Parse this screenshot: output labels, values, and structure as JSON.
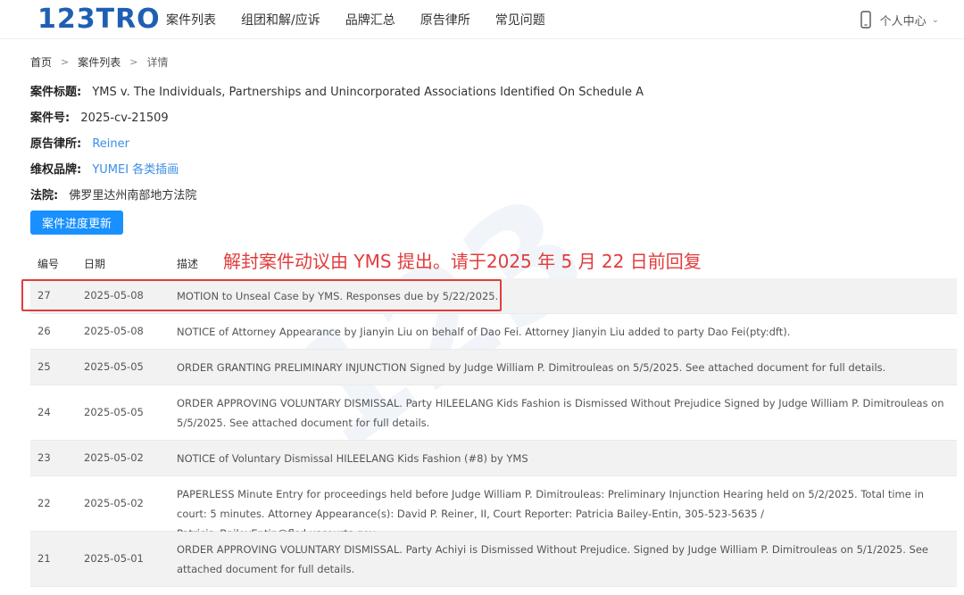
{
  "header": {
    "logo": "123TRO",
    "nav": [
      "案件列表",
      "组团和解/应诉",
      "品牌汇总",
      "原告律所",
      "常见问题"
    ],
    "user": "个人中心"
  },
  "breadcrumb": [
    "首页",
    "案件列表",
    "详情"
  ],
  "case": {
    "title_label": "案件标题:",
    "title": "YMS v. The Individuals, Partnerships and Unincorporated Associations Identified On Schedule A",
    "number_label": "案件号:",
    "number": "2025-cv-21509",
    "firm_label": "原告律所:",
    "firm": "Reiner",
    "brand_label": "维权品牌:",
    "brand": "YUMEI 各类插画",
    "court_label": "法院:",
    "court": "佛罗里达州南部地方法院"
  },
  "update_button": "案件进度更新",
  "annotation": "解封案件动议由 YMS 提出。请于2025 年 5 月 22 日前回复",
  "table": {
    "headers": [
      "编号",
      "日期",
      "描述"
    ],
    "rows": [
      {
        "no": "27",
        "date": "2025-05-08",
        "desc": "MOTION to Unseal Case by YMS. Responses due by 5/22/2025."
      },
      {
        "no": "26",
        "date": "2025-05-08",
        "desc": "NOTICE of Attorney Appearance by Jianyin Liu on behalf of Dao Fei. Attorney Jianyin Liu added to party Dao Fei(pty:dft)."
      },
      {
        "no": "25",
        "date": "2025-05-05",
        "desc": "ORDER GRANTING PRELIMINARY INJUNCTION Signed by Judge William P. Dimitrouleas on 5/5/2025. See attached document for full details."
      },
      {
        "no": "24",
        "date": "2025-05-05",
        "desc": "ORDER APPROVING VOLUNTARY DISMISSAL. Party HILEELANG Kids Fashion is Dismissed Without Prejudice Signed by Judge William P. Dimitrouleas on 5/5/2025. See attached document for full details."
      },
      {
        "no": "23",
        "date": "2025-05-02",
        "desc": "NOTICE of Voluntary Dismissal HILEELANG Kids Fashion (#8) by YMS"
      },
      {
        "no": "22",
        "date": "2025-05-02",
        "desc": "PAPERLESS Minute Entry for proceedings held before Judge William P. Dimitrouleas: Preliminary Injunction Hearing held on 5/2/2025. Total time in court: 5 minutes. Attorney Appearance(s): David P. Reiner, II, Court Reporter: Patricia Bailey-Entin, 305-523-5635 / Patricia_BaileyEntin@flsd.uscourts.gov."
      },
      {
        "no": "21",
        "date": "2025-05-01",
        "desc": "ORDER APPROVING VOLUNTARY DISMISSAL. Party Achiyi is Dismissed Without Prejudice. Signed by Judge William P. Dimitrouleas on 5/1/2025. See attached document for full details."
      }
    ]
  },
  "colors": {
    "brand": "#1f5fb3",
    "link": "#3a8ee6",
    "button": "#1890ff",
    "annotation": "#e23c3c"
  }
}
